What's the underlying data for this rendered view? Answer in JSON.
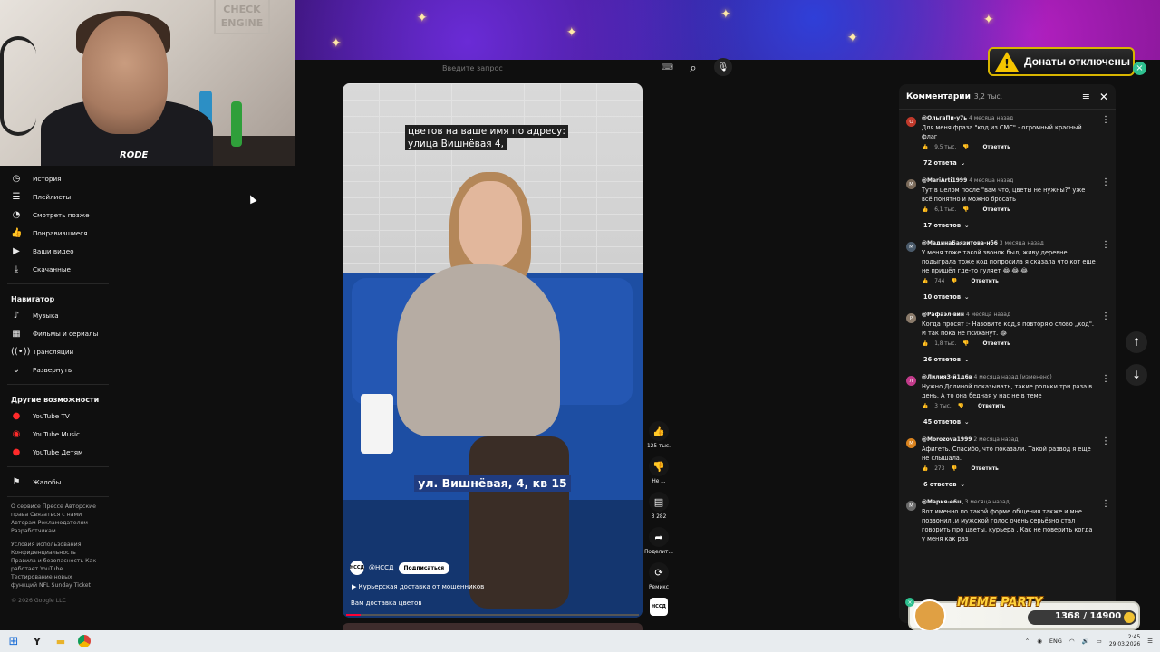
{
  "webcam": {
    "sign_text": "CHECK ENGINE",
    "mic_brand": "RODE"
  },
  "header": {
    "search_placeholder": "Введите запрос",
    "keyboard_icon": "keyboard-icon",
    "search_icon": "search-icon",
    "mic_icon": "mic-icon"
  },
  "donate": {
    "text": "Донаты отключены",
    "icon": "warning-icon",
    "close": "×"
  },
  "sidebar": {
    "items_you": [
      {
        "label": "История",
        "icon": "history-icon"
      },
      {
        "label": "Плейлисты",
        "icon": "playlists-icon"
      },
      {
        "label": "Смотреть позже",
        "icon": "watch-later-icon"
      },
      {
        "label": "Понравившиеся",
        "icon": "like-icon"
      },
      {
        "label": "Ваши видео",
        "icon": "your-videos-icon"
      },
      {
        "label": "Скачанные",
        "icon": "download-icon"
      }
    ],
    "navigator_title": "Навигатор",
    "items_nav": [
      {
        "label": "Музыка",
        "icon": "music-icon"
      },
      {
        "label": "Фильмы и сериалы",
        "icon": "movies-icon"
      },
      {
        "label": "Трансляции",
        "icon": "live-icon"
      },
      {
        "label": "Развернуть",
        "icon": "chevron-down-icon"
      }
    ],
    "more_title": "Другие возможности",
    "items_more": [
      {
        "label": "YouTube TV",
        "icon": "youtube-tv-icon"
      },
      {
        "label": "YouTube Music",
        "icon": "youtube-music-icon"
      },
      {
        "label": "YouTube Детям",
        "icon": "youtube-kids-icon"
      }
    ],
    "report": {
      "label": "Жалобы",
      "icon": "flag-icon"
    },
    "footer_group1": "О сервисе  Прессе  Авторские права  Связаться с нами  Авторам  Рекламодателям  Разработчикам",
    "footer_group2": "Условия использования  Конфиденциальность  Правила и безопасность  Как работает YouTube  Тестирование новых функций  NFL Sunday Ticket",
    "copyright": "© 2026 Google LLC"
  },
  "video": {
    "caption_top": "цветов на ваше имя по адресу: улица Вишнёвая 4,",
    "caption_mid": "ул. Вишнёвая, 4, кв 15",
    "channel_avatar": "НССД",
    "channel": "@НССД",
    "subscribe": "Подписаться",
    "promo": "Курьерская доставка от мошенников",
    "title": "Вам доставка цветов",
    "progress": 0.05
  },
  "actions": {
    "like_count": "125 тыс.",
    "dislike_label": "Не ...",
    "comments_count": "3 282",
    "share_label": "Поделит...",
    "remix_label": "Ремикс",
    "sound_label": "НССД"
  },
  "comments": {
    "title": "Комментарии",
    "count": "3,2 тыс.",
    "items": [
      {
        "author": "@ОльгаПи-у7ь",
        "time": "4 месяца назад",
        "avatar_letter": "О",
        "avatar_color": "#c0392b",
        "text": "Для меня фраза \"код из СМС\" - огромный красный флаг",
        "likes": "9,5 тыс.",
        "reply": "Ответить",
        "replies": "72 ответа"
      },
      {
        "author": "@MariArti1999",
        "time": "4 месяца назад",
        "avatar_letter": "M",
        "avatar_color": "#7a6a5a",
        "text": "Тут в целом после \"вам что, цветы не нужны?\" уже всё понятно и можно бросать",
        "likes": "6,1 тыс.",
        "reply": "Ответить",
        "replies": "17 ответов"
      },
      {
        "author": "@МадинаБаязитова-нб6",
        "time": "3 месяца назад",
        "avatar_letter": "М",
        "avatar_color": "#4a5a6a",
        "text": "У меня тоже такой звонок был, живу деревне, подыграла тоже код попросила я сказала что кот еще не пришёл где-то гуляет 😂 😂 😂",
        "likes": "744",
        "reply": "Ответить",
        "replies": "10 ответов"
      },
      {
        "author": "@Рафаэл-вйн",
        "time": "4 месяца назад",
        "avatar_letter": "Р",
        "avatar_color": "#8a7a6a",
        "text": "Когда просят :- Назовите код,я повторяю слово „код\". И так пока не психанут. 😂",
        "likes": "1,8 тыс.",
        "reply": "Ответить",
        "replies": "26 ответов"
      },
      {
        "author": "@ЛилияЗ-й1д6в",
        "time": "4 месяца назад (изменено)",
        "avatar_letter": "Л",
        "avatar_color": "#c23a8a",
        "text": "Нужно Долиной показывать, такие ролики три раза в день. А то она бедная у нас не в теме",
        "likes": "3 тыс.",
        "reply": "Ответить",
        "replies": "45 ответов"
      },
      {
        "author": "@Morozova1999",
        "time": "2 месяца назад",
        "avatar_letter": "M",
        "avatar_color": "#d8821e",
        "text": "Афигеть. Спасибо, что показали. Такой развод я еще не слышала.",
        "likes": "273",
        "reply": "Ответить",
        "replies": "6 ответов"
      },
      {
        "author": "@Мария-е6щ",
        "time": "3 месяца назад",
        "avatar_letter": "М",
        "avatar_color": "#6a6a6a",
        "text": "Вот именно по такой форме общения  также и мне позвонил ,и мужской голос очень серьёзно стал говорить про цветы, курьера . Как не поверить когда у меня как раз",
        "likes": "",
        "reply": "",
        "replies": ""
      }
    ]
  },
  "meme_widget": {
    "title": "MEME PARTY",
    "value": "1368 / 14900"
  },
  "taskbar": {
    "lang": "ENG",
    "time": "2:45",
    "date": "29.03.2026"
  },
  "colors": {
    "accent": "#ff0033",
    "donate_border": "#d8b500",
    "subscribe_bg": "#ffffff"
  }
}
